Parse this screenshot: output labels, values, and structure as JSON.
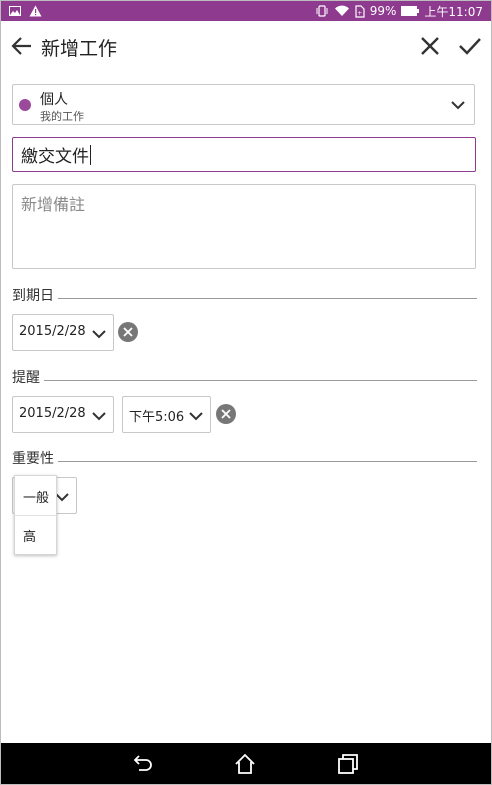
{
  "status_bar": {
    "battery_percent": "99%",
    "time": "上午11:07",
    "left_icons": [
      "image-icon",
      "warning-icon"
    ],
    "right_icons": [
      "vibrate-icon",
      "wifi-icon",
      "battery-saver-icon",
      "battery-icon"
    ]
  },
  "app_bar": {
    "title": "新增工作"
  },
  "notebook": {
    "name": "個人",
    "subtitle": "我的工作",
    "color": "#9b4a9b"
  },
  "task": {
    "title_value": "繳交文件",
    "notes_placeholder": "新增備註"
  },
  "due_date": {
    "label": "到期日",
    "date": "2015/2/28"
  },
  "reminder": {
    "label": "提醒",
    "date": "2015/2/28",
    "time": "下午5:06"
  },
  "priority": {
    "label": "重要性",
    "options": [
      "一般",
      "高"
    ]
  },
  "colors": {
    "accent": "#8e3a8e",
    "status_bar": "#8e3a8e"
  }
}
